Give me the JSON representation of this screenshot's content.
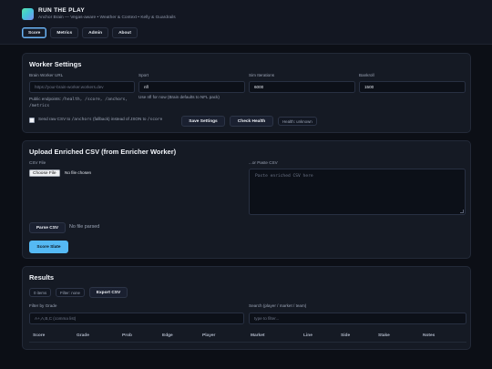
{
  "app": {
    "title": "RUN THE PLAY",
    "subtitle": "Anchor Brain — Vegas-aware • Weather & Context • Kelly & Guardrails"
  },
  "tabs": [
    {
      "label": "Score",
      "active": true
    },
    {
      "label": "Metrics",
      "active": false
    },
    {
      "label": "Admin",
      "active": false
    },
    {
      "label": "About",
      "active": false
    }
  ],
  "worker_settings": {
    "title": "Worker Settings",
    "brain_url_label": "Brain Worker URL",
    "brain_url_placeholder": "https://your-brain-worker.workers.dev",
    "sport_label": "Sport",
    "sport_value": "nfl",
    "sport_hint": "Use nfl for now (Brain defaults to NFL pack)",
    "sim_label": "Sim Iterations",
    "sim_value": "6000",
    "bankroll_label": "Bankroll",
    "bankroll_value": "1500",
    "endpoints_prefix": "Public endpoints:",
    "endpoints_line1": "/health, /score, /anchors,",
    "endpoints_line2": "/metrics",
    "raw_csv_label_prefix": "Send raw CSV to",
    "raw_csv_code1": "/anchors",
    "raw_csv_label_middle": "(fallback) instead of JSON to",
    "raw_csv_code2": "/score",
    "save_label": "Save Settings",
    "check_label": "Check Health",
    "health_status": "Health: unknown"
  },
  "upload": {
    "title": "Upload Enriched CSV (from Enricher Worker)",
    "csv_file_label": "CSV File",
    "choose_file_label": "Choose File",
    "no_file_label": "No file chosen",
    "paste_label": "...or Paste CSV",
    "paste_placeholder": "Paste enriched CSV here",
    "parse_label": "Parse CSV",
    "parse_status": "No file parsed",
    "score_label": "Score Slate"
  },
  "results": {
    "title": "Results",
    "items_badge": "0 items",
    "filter_badge": "Filter: none",
    "export_label": "Export CSV",
    "grade_filter_label": "Filter by Grade",
    "grade_filter_placeholder": "A+,A,B,C (comma list)",
    "search_label": "Search (player / market / team)",
    "search_placeholder": "type to filter...",
    "columns": [
      "Score",
      "Grade",
      "Prob",
      "Edge",
      "Player",
      "Market",
      "Line",
      "Side",
      "Stake",
      "Notes"
    ]
  }
}
